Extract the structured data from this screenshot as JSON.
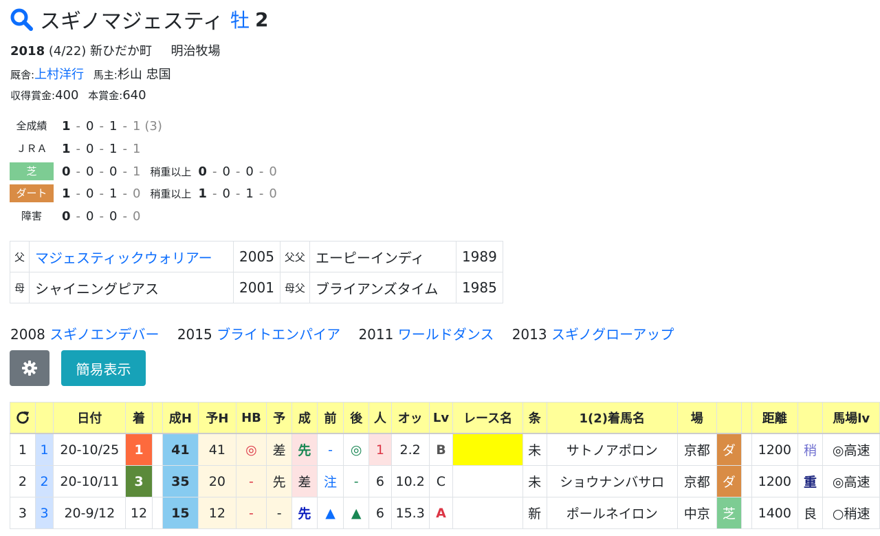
{
  "horse": {
    "name": "スギノマジェスティ",
    "sex": "牡",
    "age": "2"
  },
  "birth": {
    "year": "2018",
    "date": "(4/22)",
    "place": "新ひだか町",
    "breeder": "明治牧場"
  },
  "stable": {
    "label": "厩舎:",
    "trainer": "上村洋行",
    "owner_label": "馬主:",
    "owner": "杉山 忠国"
  },
  "prize": {
    "earned_label": "収得賞金:",
    "earned": "400",
    "main_label": "本賞金:",
    "main": "640"
  },
  "records": [
    {
      "label": "全成績",
      "vals": [
        "1",
        "0",
        "1",
        "1"
      ],
      "extra": "(3)"
    },
    {
      "label": "ＪＲＡ",
      "vals": [
        "1",
        "0",
        "1",
        "1"
      ]
    },
    {
      "label": "芝",
      "vals": [
        "0",
        "0",
        "0",
        "1"
      ],
      "sub_label": "稍重以上",
      "sub_vals": [
        "0",
        "0",
        "0",
        "0"
      ]
    },
    {
      "label": "ダート",
      "vals": [
        "1",
        "0",
        "1",
        "0"
      ],
      "sub_label": "稍重以上",
      "sub_vals": [
        "1",
        "0",
        "1",
        "0"
      ]
    },
    {
      "label": "障害",
      "vals": [
        "0",
        "0",
        "0",
        "0"
      ]
    }
  ],
  "pedigree": {
    "sire_label": "父",
    "sire": "マジェスティックウォリアー",
    "sire_year": "2005",
    "sire_sire_label": "父父",
    "sire_sire": "エーピーインディ",
    "sire_sire_year": "1989",
    "dam_label": "母",
    "dam": "シャイニングピアス",
    "dam_year": "2001",
    "dam_sire_label": "母父",
    "dam_sire": "ブライアンズタイム",
    "dam_sire_year": "1985"
  },
  "siblings": [
    {
      "year": "2008",
      "name": "スギノエンデバー"
    },
    {
      "year": "2015",
      "name": "ブライトエンパイア"
    },
    {
      "year": "2011",
      "name": "ワールドダンス"
    },
    {
      "year": "2013",
      "name": "スギノグローアップ"
    }
  ],
  "buttons": {
    "simple": "簡易表示"
  },
  "table": {
    "headers": [
      "日付",
      "着",
      "成H",
      "予H",
      "HB",
      "予",
      "成",
      "前",
      "後",
      "人",
      "オッ",
      "Lv",
      "レース名",
      "条",
      "1(2)着馬名",
      "場",
      "距離",
      "馬場lv"
    ],
    "rows": [
      {
        "n": "1",
        "idx": "1",
        "date": "20-10/25",
        "finish": "1",
        "sh": "41",
        "yh": "41",
        "hb": "◎",
        "yo": "差",
        "sei": "先",
        "mae": "-",
        "ato": "◎",
        "pop": "1",
        "odds": "2.2",
        "lv": "B",
        "race": "",
        "cond": "未",
        "winner": "サトノアポロン",
        "venue": "京都",
        "surface": "ダ",
        "dist": "1200",
        "going": "稍",
        "baba": "◎高速"
      },
      {
        "n": "2",
        "idx": "2",
        "date": "20-10/11",
        "finish": "3",
        "sh": "35",
        "yh": "20",
        "hb": "-",
        "yo": "先",
        "sei": "差",
        "mae": "注",
        "ato": "-",
        "pop": "6",
        "odds": "10.2",
        "lv": "C",
        "race": "",
        "cond": "未",
        "winner": "ショウナンバサロ",
        "venue": "京都",
        "surface": "ダ",
        "dist": "1200",
        "going": "重",
        "baba": "◎高速"
      },
      {
        "n": "3",
        "idx": "3",
        "date": "20-9/12",
        "finish": "12",
        "sh": "15",
        "yh": "12",
        "hb": "-",
        "yo": "-",
        "sei": "先",
        "mae": "▲",
        "ato": "▲",
        "pop": "6",
        "odds": "15.3",
        "lv": "A",
        "race": "",
        "cond": "新",
        "winner": "ポールネイロン",
        "venue": "中京",
        "surface": "芝",
        "dist": "1400",
        "going": "良",
        "baba": "○稍速"
      }
    ]
  }
}
